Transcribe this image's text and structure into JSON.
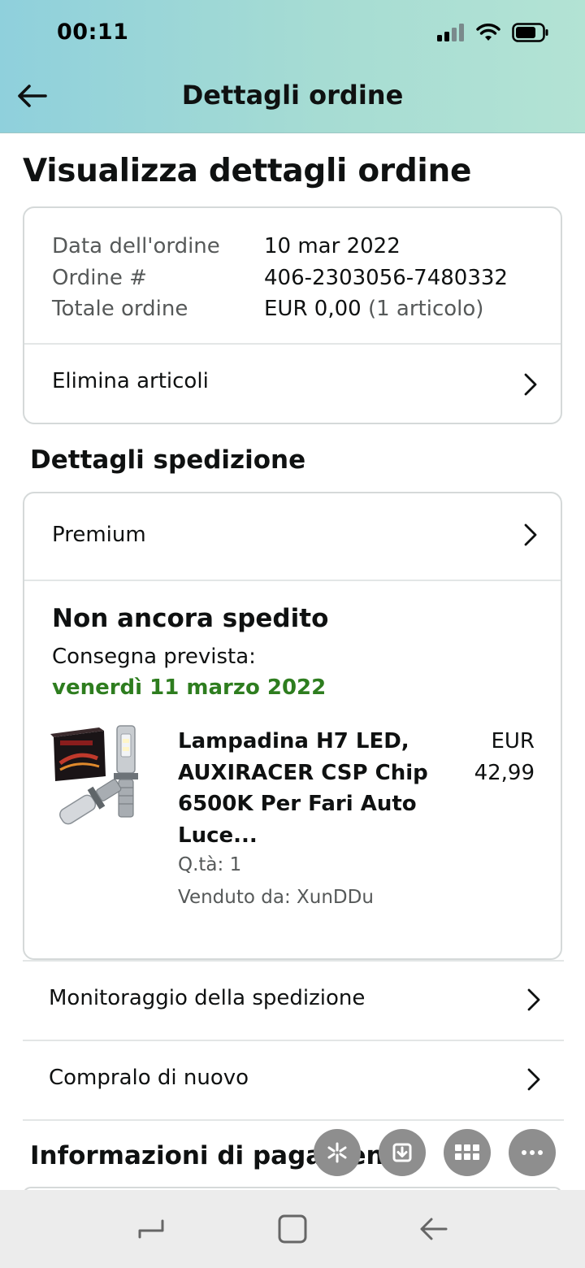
{
  "status_bar": {
    "time": "00:11"
  },
  "header": {
    "title": "Dettagli ordine"
  },
  "page": {
    "title": "Visualizza dettagli ordine"
  },
  "order_info": {
    "date_label": "Data dell'ordine",
    "date_value": "10 mar 2022",
    "number_label": "Ordine #",
    "number_value": "406-2303056-7480332",
    "total_label": "Totale ordine",
    "total_value": "EUR 0,00",
    "total_items": "(1 articolo)",
    "delete_items_label": "Elimina articoli"
  },
  "shipping": {
    "section_title": "Dettagli spedizione",
    "method_label": "Premium",
    "status": "Non ancora spedito",
    "delivery_label": "Consegna prevista:",
    "delivery_date": "venerdì 11 marzo 2022",
    "delivery_date_color": "#2e7d1f",
    "product": {
      "title_line1": "Lampadina H7 LED,",
      "title_line2": "AUXIRACER CSP Chip",
      "title_line3": "6500K Per Fari Auto",
      "title_line4": "Luce...",
      "price_currency": "EUR",
      "price_amount": "42,99",
      "quantity": "Q.tà: 1",
      "seller": "Venduto da: XunDDu"
    }
  },
  "actions": {
    "track_label": "Monitoraggio della spedizione",
    "buy_again_label": "Compralo di nuovo"
  },
  "payment": {
    "section_title": "Informazioni di pagamento"
  },
  "floating_toolbar": [
    "sparkle-icon",
    "download-icon",
    "grid-icon",
    "more-icon"
  ],
  "nav_bar": [
    "recents-icon",
    "home-icon",
    "back-icon"
  ]
}
